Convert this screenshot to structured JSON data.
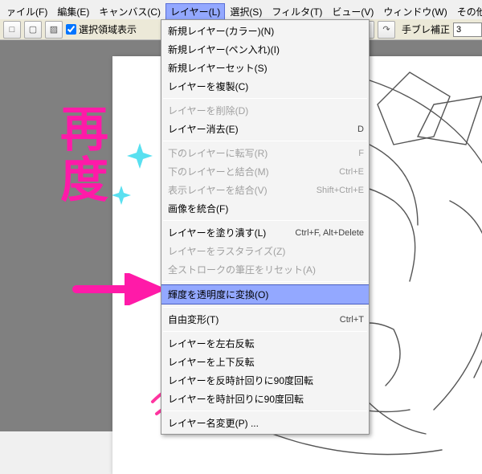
{
  "menubar": {
    "items": [
      {
        "label": "ァイル(F)"
      },
      {
        "label": "編集(E)"
      },
      {
        "label": "キャンバス(C)"
      },
      {
        "label": "レイヤー(L)",
        "highlight": true
      },
      {
        "label": "選択(S)"
      },
      {
        "label": "フィルタ(T)"
      },
      {
        "label": "ビュー(V)"
      },
      {
        "label": "ウィンドウ(W)"
      },
      {
        "label": "その他(O)"
      }
    ]
  },
  "toolbar": {
    "selection_display": "選択領域表示",
    "stabilizer_label": "手ブレ補正",
    "stabilizer_value": "3"
  },
  "dropdown": {
    "items": [
      {
        "label": "新規レイヤー(カラー)(N)"
      },
      {
        "label": "新規レイヤー(ペン入れ)(I)"
      },
      {
        "label": "新規レイヤーセット(S)"
      },
      {
        "label": "レイヤーを複製(C)"
      },
      {
        "sep": true
      },
      {
        "label": "レイヤーを削除(D)",
        "disabled": true
      },
      {
        "label": "レイヤー消去(E)",
        "shortcut": "D"
      },
      {
        "sep": true
      },
      {
        "label": "下のレイヤーに転写(R)",
        "shortcut": "F",
        "disabled": true
      },
      {
        "label": "下のレイヤーと結合(M)",
        "shortcut": "Ctrl+E",
        "disabled": true
      },
      {
        "label": "表示レイヤーを結合(V)",
        "shortcut": "Shift+Ctrl+E",
        "disabled": true
      },
      {
        "label": "画像を統合(F)"
      },
      {
        "sep": true
      },
      {
        "label": "レイヤーを塗り潰す(L)",
        "shortcut": "Ctrl+F, Alt+Delete"
      },
      {
        "label": "レイヤーをラスタライズ(Z)",
        "disabled": true
      },
      {
        "label": "全ストロークの筆圧をリセット(A)",
        "disabled": true
      },
      {
        "sep": true
      },
      {
        "label": "輝度を透明度に変換(O)",
        "highlight": true
      },
      {
        "sep": true
      },
      {
        "label": "自由変形(T)",
        "shortcut": "Ctrl+T"
      },
      {
        "sep": true
      },
      {
        "label": "レイヤーを左右反転"
      },
      {
        "label": "レイヤーを上下反転"
      },
      {
        "label": "レイヤーを反時計回りに90度回転"
      },
      {
        "label": "レイヤーを時計回りに90度回転"
      },
      {
        "sep": true
      },
      {
        "label": "レイヤー名変更(P) ..."
      }
    ]
  },
  "annotation": {
    "line1": "再",
    "line2": "度"
  }
}
